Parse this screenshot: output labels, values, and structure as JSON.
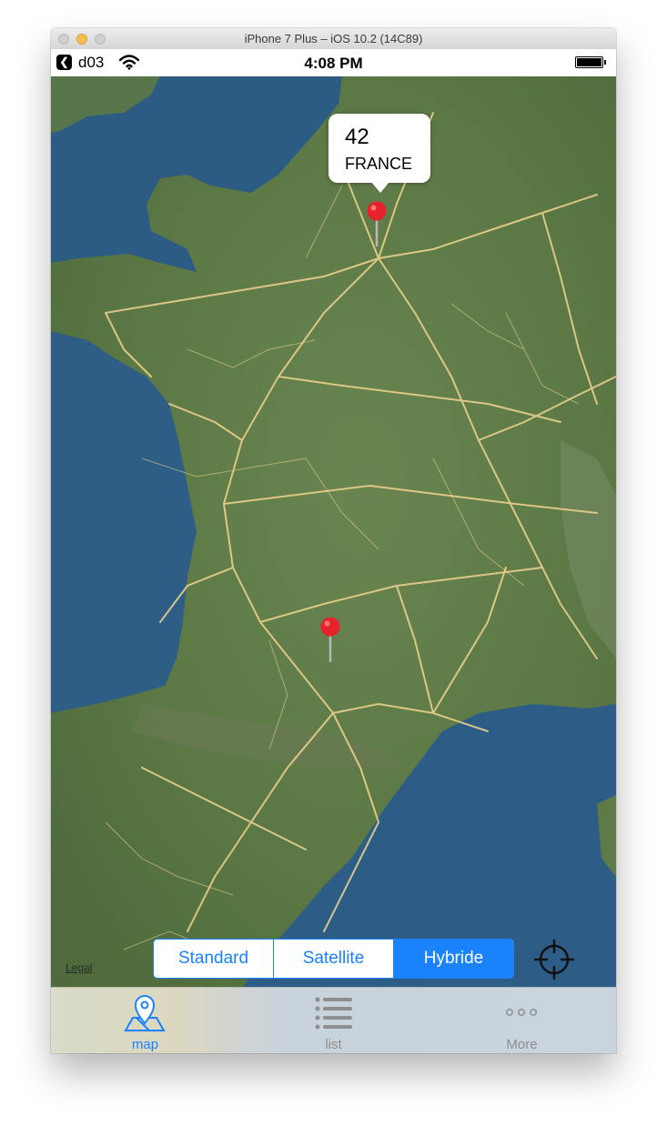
{
  "window": {
    "title": "iPhone 7 Plus – iOS 10.2 (14C89)"
  },
  "status_bar": {
    "back_glyph": "❮",
    "carrier": "d03",
    "time": "4:08 PM"
  },
  "map": {
    "callout": {
      "title": "42",
      "subtitle": "FRANCE"
    },
    "legal_label": "Legal",
    "map_types": [
      "Standard",
      "Satellite",
      "Hybride"
    ],
    "selected_map_type": "Hybride",
    "pin_color": "#e8222b"
  },
  "tab_bar": {
    "tabs": [
      {
        "label": "map",
        "icon": "map-pin-icon",
        "selected": true
      },
      {
        "label": "list",
        "icon": "list-icon",
        "selected": false
      },
      {
        "label": "More",
        "icon": "more-icon",
        "selected": false
      }
    ]
  },
  "colors": {
    "accent": "#1a82fb",
    "water": "#2f5f84",
    "land": "#5a7a45",
    "roads": "#f2d48f"
  }
}
